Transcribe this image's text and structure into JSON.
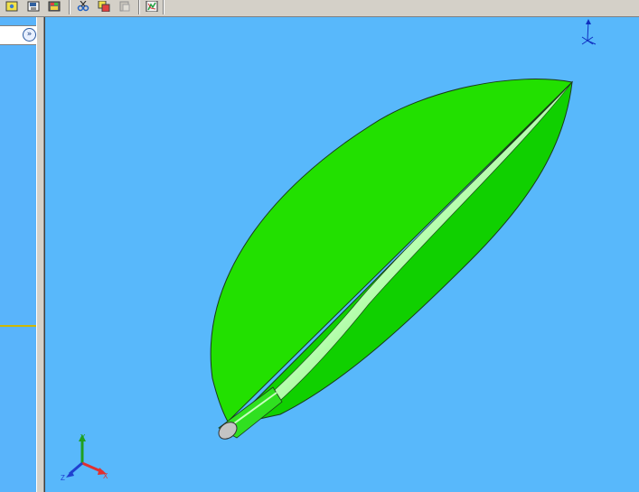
{
  "toolbar": {
    "buttons": [
      {
        "icon": "zoom-to-area-icon"
      },
      {
        "icon": "save-view-icon"
      },
      {
        "icon": "display-style-icon"
      },
      {
        "icon": "cut-icon"
      },
      {
        "icon": "copy-icon"
      },
      {
        "icon": "paste-icon"
      },
      {
        "icon": "rebuild-icon"
      }
    ]
  },
  "left_panel": {
    "expand_icon": "expand-double-chevron-icon",
    "expand_glyph": "»"
  },
  "viewport": {
    "background_color": "#58b8fb",
    "model_color": "#22e000",
    "model_edge_color": "#1a3a1a",
    "triad": {
      "labels": {
        "x": "X",
        "y": "Y",
        "z": "Z"
      },
      "colors": {
        "x": "#e03030",
        "y": "#20a020",
        "z": "#2040d0"
      }
    }
  }
}
